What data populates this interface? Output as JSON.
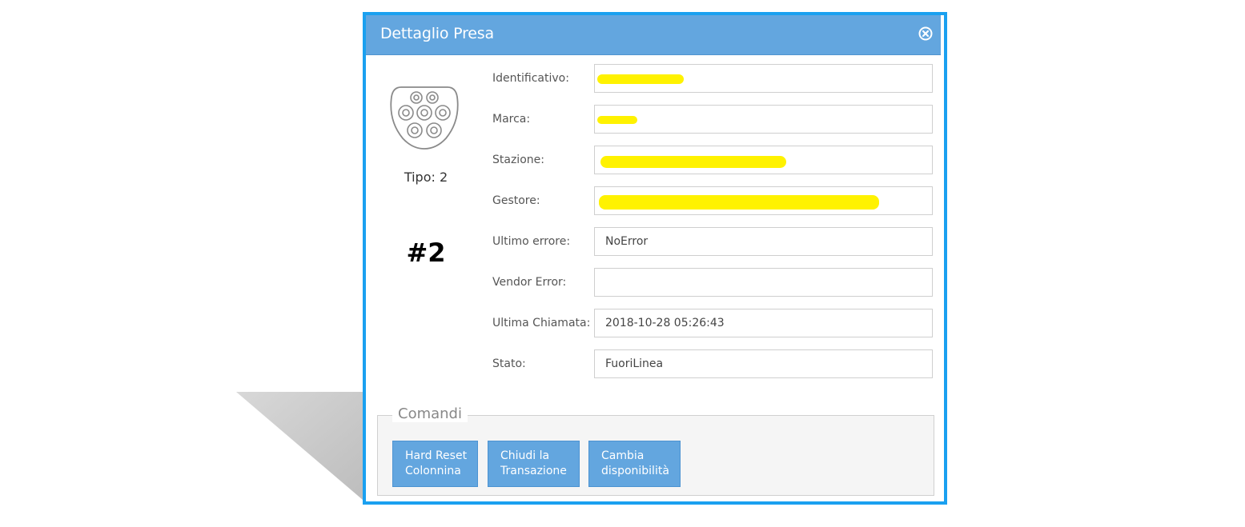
{
  "dialog": {
    "title": "Dettaglio Presa",
    "close_icon": "close-circle-icon"
  },
  "connector": {
    "icon": "type2-plug-icon",
    "tipo_label": "Tipo: 2",
    "numero": "#2"
  },
  "fields": {
    "identificativo": {
      "label": "Identificativo:",
      "value": ""
    },
    "marca": {
      "label": "Marca:",
      "value": ""
    },
    "stazione": {
      "label": "Stazione:",
      "value": ""
    },
    "gestore": {
      "label": "Gestore:",
      "value": ""
    },
    "ultimo_errore": {
      "label": "Ultimo errore:",
      "value": "NoError"
    },
    "vendor_error": {
      "label": "Vendor Error:",
      "value": ""
    },
    "ultima_chiamata": {
      "label": "Ultima Chiamata:",
      "value": "2018-10-28 05:26:43"
    },
    "stato": {
      "label": "Stato:",
      "value": "FuoriLinea"
    }
  },
  "comandi": {
    "legend": "Comandi",
    "buttons": [
      {
        "line1": "Hard Reset",
        "line2": "Colonnina"
      },
      {
        "line1": "Chiudi la",
        "line2": "Transazione"
      },
      {
        "line1": "Cambia",
        "line2": "disponibilità"
      }
    ]
  },
  "colors": {
    "titlebar": "#63a6df",
    "dialog_border": "#1aa0f0",
    "redaction": "#fff200"
  }
}
